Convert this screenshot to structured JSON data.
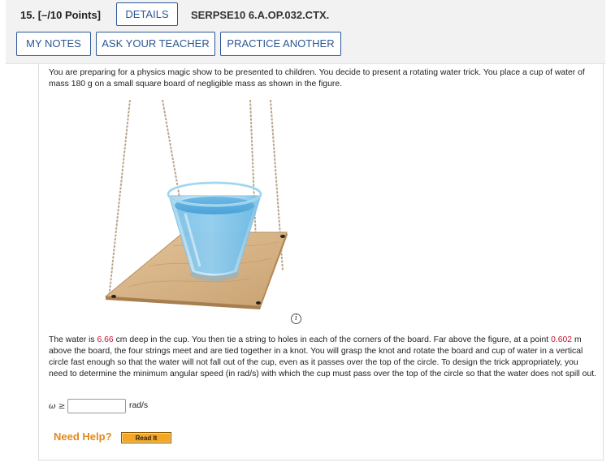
{
  "header": {
    "question_number": "15.",
    "points": "[–/10 Points]",
    "details_label": "DETAILS",
    "question_code": "SERPSE10 6.A.OP.032.CTX.",
    "my_notes_label": "MY NOTES",
    "ask_teacher_label": "ASK YOUR TEACHER",
    "practice_another_label": "PRACTICE ANOTHER"
  },
  "problem": {
    "intro_text": "You are preparing for a physics magic show to be presented to children. You decide to present a rotating water trick. You place a cup of water of mass 180 g on a small square board of negligible mass as shown in the figure.",
    "body_part1": "The water is ",
    "depth_value": "6.66",
    "body_part2": " cm deep in the cup. You then tie a string to holes in each of the corners of the board. Far above the figure, at a point ",
    "height_value": "0.602",
    "body_part3": " m above the board, the four strings meet and are tied together in a knot. You will grasp the knot and rotate the board and cup of water in a vertical circle fast enough so that the water will not fall out of the cup, even as it passes over the top of the circle. To design the trick appropriately, you need to determine the minimum angular speed (in rad/s) with which the cup must pass over the top of the circle so that the water does not spill out.",
    "info_icon_glyph": "i"
  },
  "answer": {
    "symbol": "ω ≥",
    "value": "",
    "unit": "rad/s"
  },
  "help": {
    "need_help_label": "Need Help?",
    "read_it_label": "Read It"
  },
  "colors": {
    "accent": "#2b5797",
    "red_value": "#c8102e",
    "help_orange": "#e08a1e"
  }
}
